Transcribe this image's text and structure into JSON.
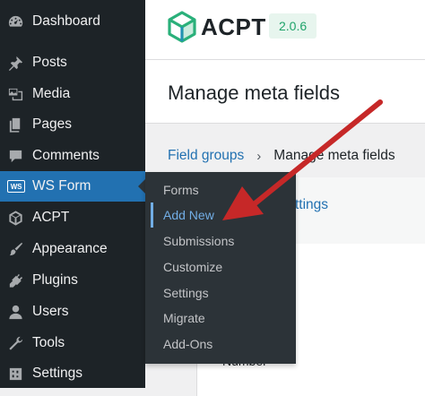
{
  "sidebar": {
    "items": [
      {
        "label": "Dashboard",
        "icon": "dashboard-icon"
      },
      {
        "label": "Posts",
        "icon": "pushpin-icon"
      },
      {
        "label": "Media",
        "icon": "media-icon"
      },
      {
        "label": "Pages",
        "icon": "pages-icon"
      },
      {
        "label": "Comments",
        "icon": "comment-icon"
      },
      {
        "label": "WS Form",
        "icon": "wsform-icon",
        "badge": "WS"
      },
      {
        "label": "ACPT",
        "icon": "cube-icon"
      },
      {
        "label": "Appearance",
        "icon": "paintbrush-icon"
      },
      {
        "label": "Plugins",
        "icon": "plug-icon"
      },
      {
        "label": "Users",
        "icon": "user-icon"
      },
      {
        "label": "Tools",
        "icon": "wrench-icon"
      },
      {
        "label": "Settings",
        "icon": "settings-icon"
      }
    ],
    "active": "WS Form"
  },
  "flyout": {
    "items": [
      {
        "label": "Forms"
      },
      {
        "label": "Add New"
      },
      {
        "label": "Submissions"
      },
      {
        "label": "Customize"
      },
      {
        "label": "Settings"
      },
      {
        "label": "Migrate"
      },
      {
        "label": "Add-Ons"
      }
    ],
    "current": "Add New"
  },
  "header": {
    "logo_text": "ACPT",
    "version": "2.0.6"
  },
  "page": {
    "title": "Manage meta fields",
    "breadcrumb": {
      "link": "Field groups",
      "separator": "›",
      "current": "Manage meta fields"
    },
    "settings_tab": "Settings",
    "partial_label": "Number"
  },
  "colors": {
    "sidebar_bg": "#1d2327",
    "active_bg": "#2271b1",
    "flyout_bg": "#2c3338",
    "current_link": "#72aee6",
    "arrow": "#c62828",
    "version_bg": "#e7f5ee",
    "version_text": "#1fa36a"
  }
}
